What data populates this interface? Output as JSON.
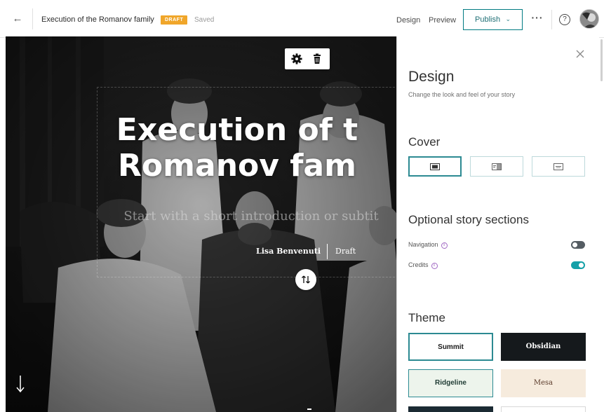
{
  "topbar": {
    "back_icon": "back-arrow-icon",
    "story_title": "Execution of the Romanov family",
    "status_badge": "DRAFT",
    "saved_status": "Saved",
    "design_link": "Design",
    "preview_link": "Preview",
    "publish_label": "Publish",
    "more_label": "···",
    "help_label": "?",
    "colors": {
      "badge": "#f0a62a",
      "accent": "#007b82"
    }
  },
  "cover": {
    "title_line1": "Execution of t",
    "title_line2": "Romanov fam",
    "subtitle_placeholder": "Start with a short introduction or subtit",
    "author": "Lisa Benvenuti",
    "author_state": "Draft",
    "toolbar_icons": [
      "gear-icon",
      "trash-icon"
    ]
  },
  "panel": {
    "title": "Design",
    "description": "Change the look and feel of your story",
    "cover_section": "Cover",
    "cover_options": [
      {
        "name": "cover-option-full",
        "selected": true
      },
      {
        "name": "cover-option-side",
        "selected": false
      },
      {
        "name": "cover-option-minimal",
        "selected": false
      }
    ],
    "optional_section": "Optional story sections",
    "toggles": [
      {
        "label": "Navigation",
        "on": false
      },
      {
        "label": "Credits",
        "on": true
      }
    ],
    "theme_section": "Theme",
    "themes": [
      {
        "label": "Summit",
        "bg": "#ffffff",
        "fg": "#1a1a1a",
        "border": "#2c8a92",
        "selected": true
      },
      {
        "label": "Obsidian",
        "bg": "#15191c",
        "fg": "#ffffff",
        "border": "#15191c",
        "selected": false
      },
      {
        "label": "Ridgeline",
        "bg": "#edf4ec",
        "fg": "#1f3b34",
        "border": "#2c8a92",
        "selected": false
      },
      {
        "label": "Mesa",
        "bg": "#f6ebdd",
        "fg": "#5a3a2a",
        "border": "#f6ebdd",
        "selected": false
      }
    ],
    "toggle_on_color": "#14a0a8",
    "toggle_off_color": "#555d63"
  }
}
